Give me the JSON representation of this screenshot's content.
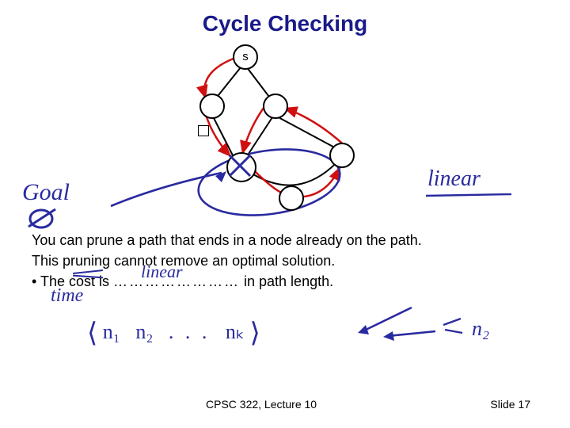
{
  "title": "Cycle Checking",
  "diagram": {
    "start_node_label": "s"
  },
  "handwriting": {
    "goal": "Goal",
    "linear": "linear",
    "linear_over_dots": "linear",
    "time": "time",
    "seq_open": "⟨",
    "seq_n1": "n₁",
    "seq_n2": "n₂",
    "seq_dots": ". . .",
    "seq_nk": "nₖ",
    "seq_close": "⟩",
    "arrow_n2": "n₂"
  },
  "body": {
    "line1": "You can prune a path that ends in a node already on the path.",
    "line2": "This pruning cannot remove an optimal solution.",
    "line3_pre": "• The cost is ",
    "line3_dots": "……………………",
    "line3_post": " in path length."
  },
  "footer": {
    "left": "CPSC 322, Lecture 10",
    "right": "Slide 17"
  }
}
